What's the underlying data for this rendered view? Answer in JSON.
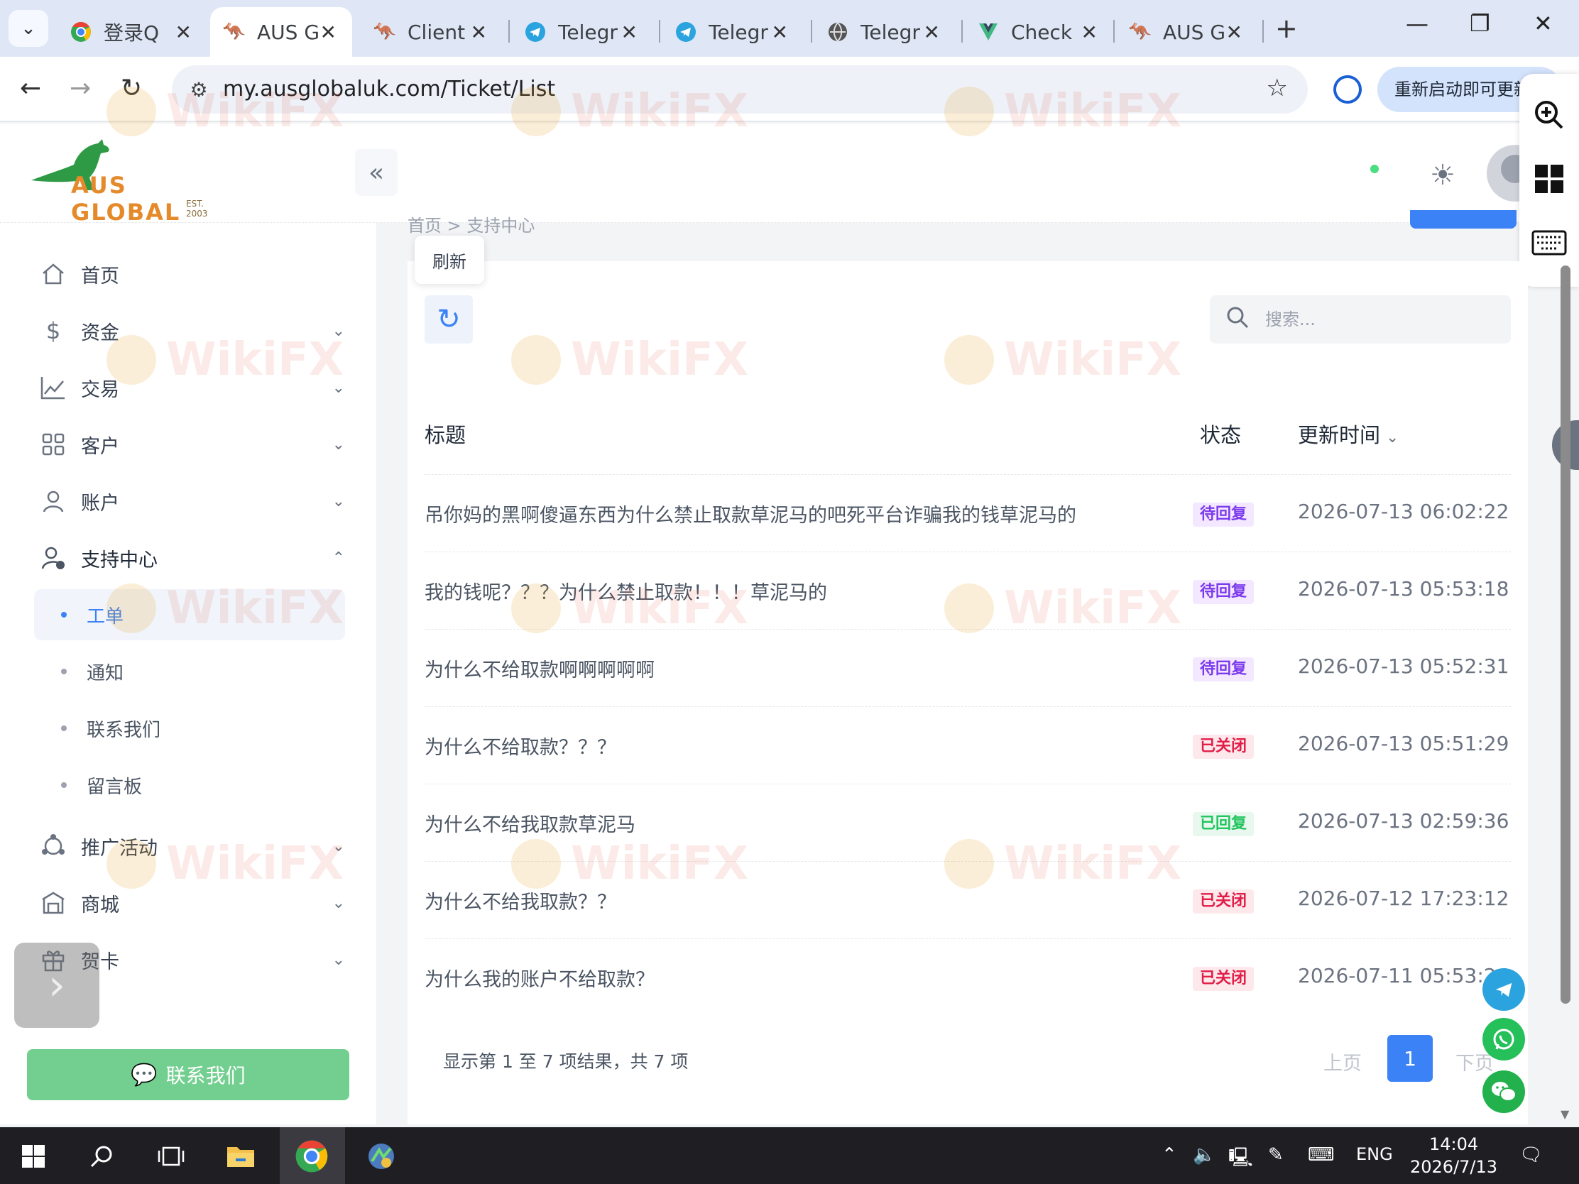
{
  "browser": {
    "tabs": [
      {
        "title": "登录Q",
        "favicon": "chrome-icon"
      },
      {
        "title": "AUS G",
        "favicon": "kangaroo-icon",
        "active": true
      },
      {
        "title": "Client",
        "favicon": "kangaroo-icon"
      },
      {
        "title": "Telegr",
        "favicon": "telegram-icon"
      },
      {
        "title": "Telegr",
        "favicon": "telegram-icon"
      },
      {
        "title": "Telegr",
        "favicon": "globe-icon"
      },
      {
        "title": "Check",
        "favicon": "vue-icon"
      },
      {
        "title": "AUS G",
        "favicon": "kangaroo-icon"
      }
    ],
    "url": "my.ausglobaluk.com/Ticket/List",
    "update_label": "重新启动即可更新"
  },
  "brand": {
    "name": "AUS GLOBAL",
    "est": "EST. 2003"
  },
  "sidebar": {
    "items": [
      {
        "label": "首页",
        "icon": "home-icon"
      },
      {
        "label": "资金",
        "icon": "dollar-icon"
      },
      {
        "label": "交易",
        "icon": "chart-line-icon"
      },
      {
        "label": "客户",
        "icon": "grid-icon"
      },
      {
        "label": "账户",
        "icon": "user-icon"
      },
      {
        "label": "支持中心",
        "icon": "user-check-icon"
      }
    ],
    "support_sub": [
      {
        "label": "工单",
        "active": true
      },
      {
        "label": "通知"
      },
      {
        "label": "联系我们"
      },
      {
        "label": "留言板"
      }
    ],
    "more_items": [
      {
        "label": "推广活动",
        "icon": "share-icon"
      },
      {
        "label": "商城",
        "icon": "store-icon"
      },
      {
        "label": "贺卡",
        "icon": "gift-icon"
      }
    ],
    "contact_button": "联系我们"
  },
  "breadcrumb": "首页 > 支持中心",
  "toolbar": {
    "refresh_tooltip": "刷新",
    "search_placeholder": "搜索..."
  },
  "table": {
    "headers": {
      "title": "标题",
      "status": "状态",
      "updated": "更新时间"
    },
    "rows": [
      {
        "title": "吊你妈的黑啊傻逼东西为什么禁止取款草泥马的吧死平台诈骗我的钱草泥马的",
        "status": "待回复",
        "time": "2026-07-13 06:02:22"
      },
      {
        "title": "我的钱呢？？？为什么禁止取款！！！草泥马的",
        "status": "待回复",
        "time": "2026-07-13 05:53:18"
      },
      {
        "title": "为什么不给取款啊啊啊啊啊",
        "status": "待回复",
        "time": "2026-07-13 05:52:31"
      },
      {
        "title": "为什么不给取款？？？",
        "status": "已关闭",
        "time": "2026-07-13 05:51:29"
      },
      {
        "title": "为什么不给我取款草泥马",
        "status": "已回复",
        "time": "2026-07-13 02:59:36"
      },
      {
        "title": "为什么不给我取款？？",
        "status": "已关闭",
        "time": "2026-07-12 17:23:12"
      },
      {
        "title": "为什么我的账户不给取款？",
        "status": "已关闭",
        "time": "2026-07-11 05:53:24"
      }
    ],
    "status_colors": {
      "待回复": {
        "fg": "#7c3aed",
        "bg": "#f3e8ff"
      },
      "已关闭": {
        "fg": "#e11d48",
        "bg": "#fde8ec"
      },
      "已回复": {
        "fg": "#22c55e",
        "bg": "#e8f8ee"
      }
    }
  },
  "pagination": {
    "info": "显示第 1 至 7 项结果，共 7 项",
    "prev": "上页",
    "current": "1",
    "next": "下页"
  },
  "watermark": "WikiFX",
  "taskbar": {
    "lang": "ENG",
    "time": "14:04",
    "date": "2026/7/13"
  }
}
